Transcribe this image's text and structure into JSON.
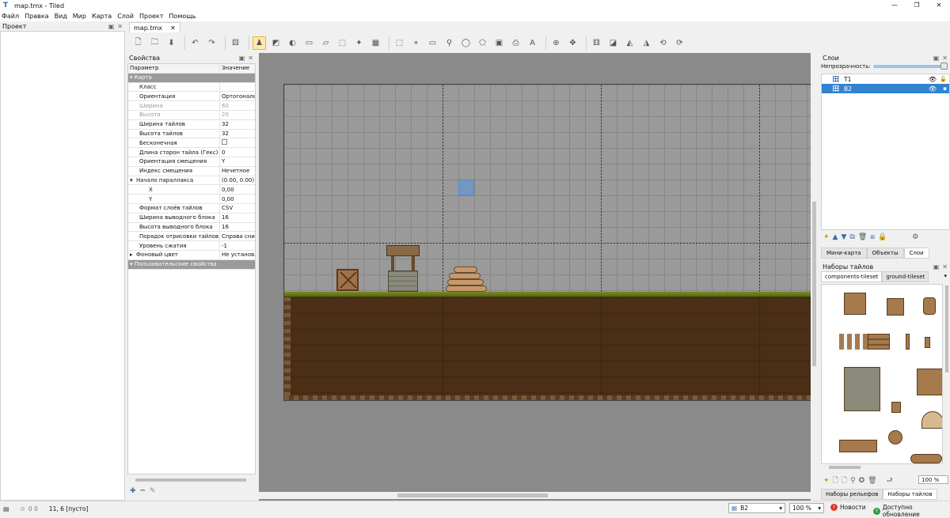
{
  "window": {
    "title": "map.tmx - Tiled",
    "controls": [
      "—",
      "❐",
      "✕"
    ]
  },
  "menu": [
    "Файл",
    "Правка",
    "Вид",
    "Мир",
    "Карта",
    "Слой",
    "Проект",
    "Помощь"
  ],
  "project_panel": {
    "title": "Проект"
  },
  "doc_tab": {
    "label": "map.tmx",
    "close": "✕"
  },
  "properties": {
    "title": "Свойства",
    "col_param": "Параметр",
    "col_value": "Значение",
    "group_map": "Карта",
    "rows": [
      {
        "k": "Класс",
        "v": ""
      },
      {
        "k": "Ориентация",
        "v": "Ортогональн"
      },
      {
        "k": "Ширина",
        "v": "60"
      },
      {
        "k": "Высота",
        "v": "20"
      },
      {
        "k": "Ширина тайлов",
        "v": "32"
      },
      {
        "k": "Высота тайлов",
        "v": "32"
      },
      {
        "k": "Бесконечная",
        "v": ""
      },
      {
        "k": "Длина сторон тайла (Гекс)",
        "v": "0"
      },
      {
        "k": "Ориентация смещения",
        "v": "Y"
      },
      {
        "k": "Индекс смещения",
        "v": "Нечетное"
      },
      {
        "k": "Начало параллакса",
        "v": "(0.00, 0.00)"
      },
      {
        "k": "X",
        "v": "0,00"
      },
      {
        "k": "Y",
        "v": "0,00"
      },
      {
        "k": "Формат слоёв тайлов",
        "v": "CSV"
      },
      {
        "k": "Ширина выводного блока",
        "v": "16"
      },
      {
        "k": "Высота выводного блока",
        "v": "16"
      },
      {
        "k": "Порядок отрисовки тайлов",
        "v": "Справа снизу"
      },
      {
        "k": "Уровень сжатия",
        "v": "-1"
      },
      {
        "k": "Фоновый цвет",
        "v": "Не установле"
      }
    ],
    "group_custom": "Пользовательские свойства"
  },
  "layers": {
    "title": "Слои",
    "opacity_label": "Непрозрачность:",
    "opacity": 1.0,
    "items": [
      {
        "name": "T1"
      },
      {
        "name": "B2"
      }
    ],
    "tabs": [
      "Мини-карта",
      "Объекты",
      "Слои"
    ]
  },
  "tilesets": {
    "title": "Наборы тайлов",
    "tabs": [
      "components-tileset",
      "ground-tileset"
    ],
    "zoom": "100 %",
    "bottom_tabs": [
      "Наборы рельефов",
      "Наборы тайлов"
    ]
  },
  "status": {
    "counters": "0   0",
    "position": "11, 6 [пусто]",
    "layer": "B2",
    "zoom": "100 %",
    "news": "Новости",
    "update": "Доступно обновление"
  },
  "colors": {
    "accent": "#3183d0",
    "map_bg": "#8a8a8a",
    "dirt": "#4a2e16",
    "grass": "#6a7a1c"
  }
}
